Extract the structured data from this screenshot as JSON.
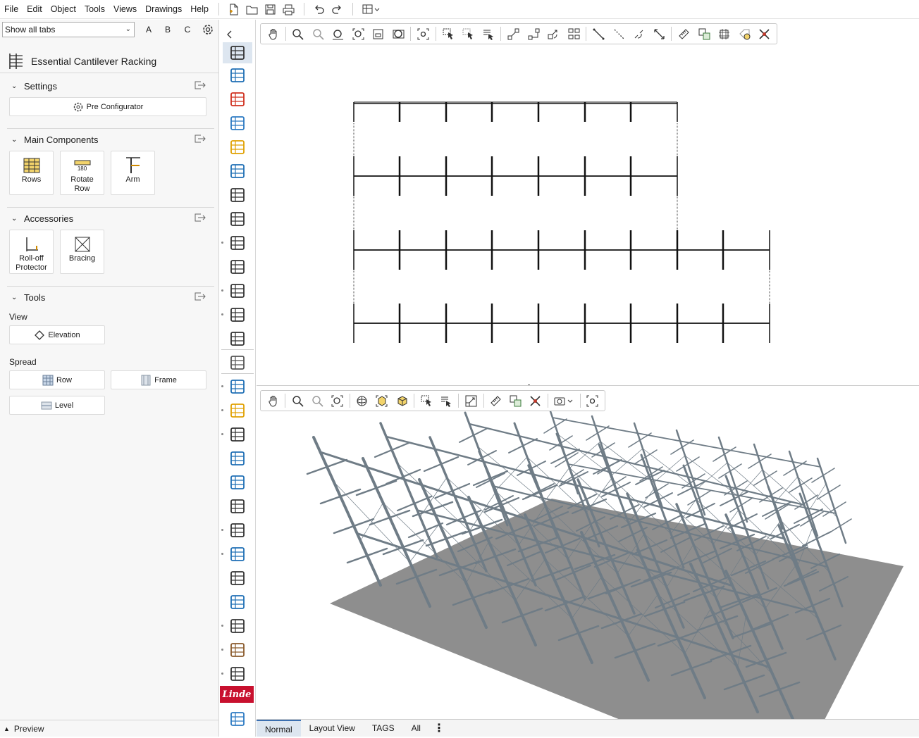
{
  "menu": [
    "File",
    "Edit",
    "Object",
    "Tools",
    "Views",
    "Drawings",
    "Help"
  ],
  "quick_access_icons": [
    "new-file-icon",
    "open-folder-icon",
    "save-icon",
    "print-icon",
    "undo-icon",
    "redo-icon",
    "layout-icon"
  ],
  "left_panel": {
    "tab_filter": "Show all tabs",
    "letters": [
      "A",
      "B",
      "C"
    ],
    "module_title": "Essential Cantilever Racking",
    "settings": {
      "title": "Settings",
      "pre_configurator": "Pre Configurator"
    },
    "main_components": {
      "title": "Main Components",
      "rows": "Rows",
      "rotate_row": "Rotate\nRow",
      "rotate_row_line1": "Rotate",
      "rotate_row_line2": "Row",
      "rotate_badge": "180",
      "arm": "Arm"
    },
    "accessories": {
      "title": "Accessories",
      "rolloff_line1": "Roll-off",
      "rolloff_line2": "Protector",
      "bracing": "Bracing"
    },
    "tools": {
      "title": "Tools",
      "view_label": "View",
      "elevation": "Elevation",
      "spread_label": "Spread",
      "row": "Row",
      "frame": "Frame",
      "level": "Level"
    },
    "preview": "Preview"
  },
  "icon_strip": [
    "cantilever-rack-icon",
    "tools-icon",
    "connector-icon",
    "rings-icon",
    "wall-icon",
    "sketchup-icon",
    "glasses-icon",
    "pallet-rack-icon",
    "shelving-icon",
    "conveyor-icon",
    "racking-grid-icon",
    "racking-frame-icon",
    "shelves-icon",
    "safety-icon",
    "stairs-icon",
    "stair-rail-icon",
    "mezzanine-icon",
    "fire-icon",
    "barrier-icon",
    "gears-icon",
    "robot-icon",
    "gauge-icon",
    "catalog-icon",
    "link-icon",
    "document-icon",
    "plant-icon",
    "forklift-icon",
    "linde-logo",
    "panels-icon"
  ],
  "linde_label": "Linde",
  "bottom_tabs": [
    "Normal",
    "Layout View",
    "TAGS",
    "All"
  ],
  "active_tab": "Normal",
  "colors": {
    "accent": "#3b6fb0",
    "floor": "#8e8e8e",
    "rack_steel": "#6f7c86"
  }
}
